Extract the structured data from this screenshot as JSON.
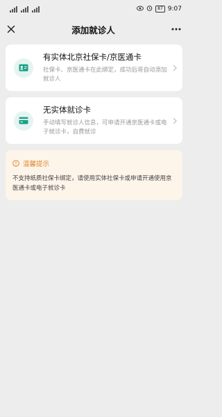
{
  "status_bar": {
    "time": "9:07",
    "battery": "87"
  },
  "nav": {
    "title": "添加就诊人"
  },
  "cards": [
    {
      "title": "有实体北京社保卡/京医通卡",
      "desc": "社保卡、京医通卡在此绑定，成功后将自动添加就诊人"
    },
    {
      "title": "无实体就诊卡",
      "desc": "手动填写就诊人信息，可申请开通京医通卡或电子就诊卡，自费就诊"
    }
  ],
  "notice": {
    "title": "温馨提示",
    "text": "不支持纸质社保卡绑定，请使用实体社保卡或申请开通使用京医通卡或电子就诊卡"
  },
  "colors": {
    "accent": "#1aa087",
    "icon_bg": "#e4f4f1",
    "notice_bg": "#fdf4ea",
    "notice_title": "#e08a2e",
    "page_bg": "#ededed"
  }
}
